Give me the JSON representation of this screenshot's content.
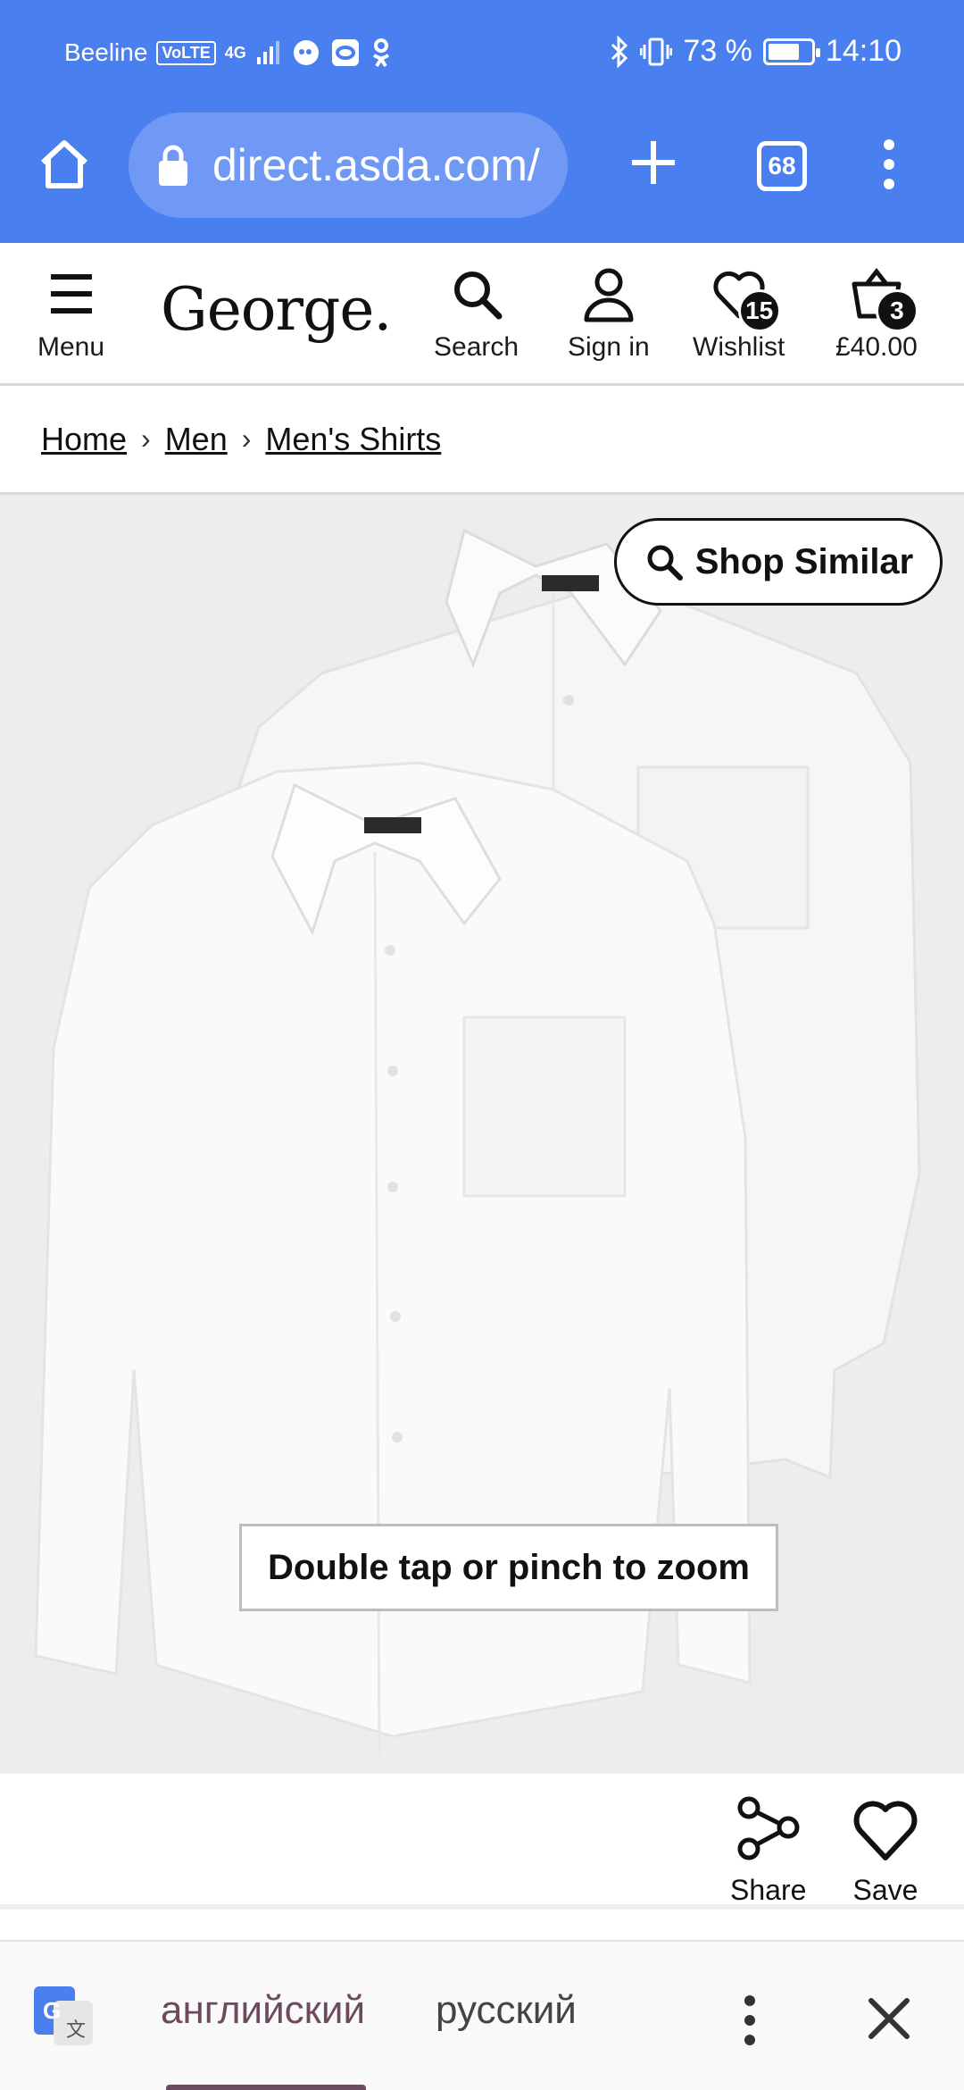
{
  "status_bar": {
    "carrier": "Beeline",
    "volte": "VoLTE",
    "network": "4G",
    "battery_percent": "73 %",
    "battery_level": 0.73,
    "time": "14:10"
  },
  "browser": {
    "url": "direct.asda.com/",
    "tab_count": "68"
  },
  "header": {
    "menu_label": "Menu",
    "logo_text": "George.",
    "search_label": "Search",
    "signin_label": "Sign in",
    "wishlist_label": "Wishlist",
    "wishlist_count": "15",
    "basket_count": "3",
    "basket_total": "£40.00"
  },
  "breadcrumb": {
    "items": [
      "Home",
      "Men",
      "Men's Shirts"
    ]
  },
  "product": {
    "shop_similar_label": "Shop Similar",
    "zoom_hint": "Double tap or pinch to zoom"
  },
  "actions": {
    "share_label": "Share",
    "save_label": "Save"
  },
  "translate": {
    "source_lang": "английский",
    "target_lang": "русский"
  },
  "colors": {
    "browser_blue": "#4a7ff0",
    "translate_accent": "#6d4b5e"
  }
}
